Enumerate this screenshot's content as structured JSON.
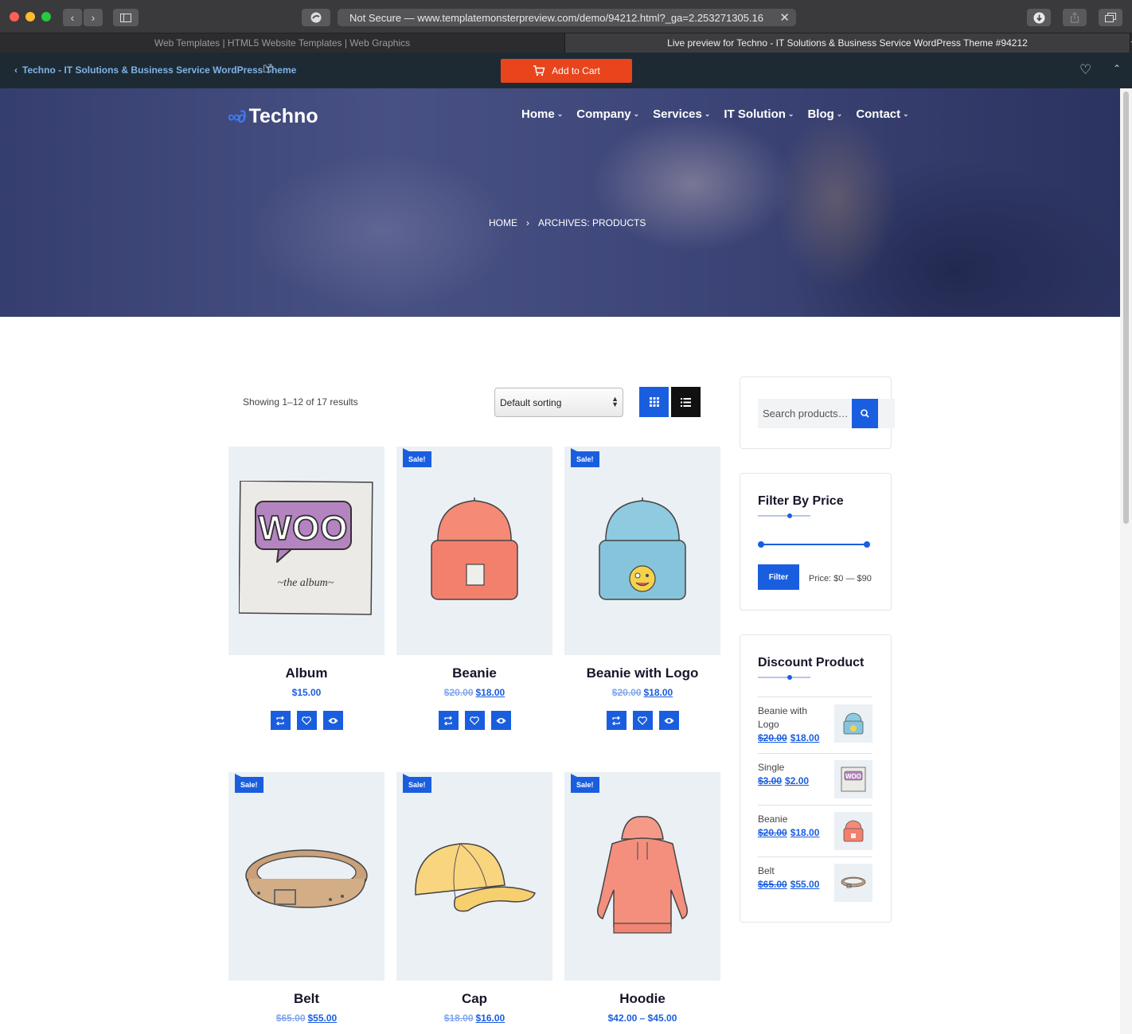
{
  "browser": {
    "url_text": "Not Secure — www.templatemonsterpreview.com/demo/94212.html?_ga=2.253271305.16",
    "tabs": [
      {
        "label": "Web Templates | HTML5 Website Templates | Web Graphics",
        "active": false
      },
      {
        "label": "Live preview for Techno - IT Solutions & Business Service WordPress Theme #94212",
        "active": true
      }
    ]
  },
  "preview_bar": {
    "back_label": "Techno - IT Solutions & Business Service WordPress Theme",
    "add_to_cart_label": "Add to Cart",
    "accent_color": "#e8451d"
  },
  "site": {
    "logo_text": "Techno",
    "menu": [
      "Home",
      "Company",
      "Services",
      "IT Solution",
      "Blog",
      "Contact"
    ],
    "breadcrumb": {
      "home": "HOME",
      "current": "ARCHIVES: PRODUCTS"
    },
    "brand_color": "#1a5ee0"
  },
  "shop": {
    "results_text": "Showing 1–12 of 17 results",
    "sort_selected": "Default sorting",
    "sale_badge": "Sale!",
    "products": [
      {
        "name": "Album",
        "price": "$15.00",
        "old_price": "",
        "sale": false,
        "image": "album-image"
      },
      {
        "name": "Beanie",
        "price": "$18.00",
        "old_price": "$20.00",
        "sale": true,
        "image": "beanie-image"
      },
      {
        "name": "Beanie with Logo",
        "price": "$18.00",
        "old_price": "$20.00",
        "sale": true,
        "image": "beanie-logo-image"
      },
      {
        "name": "Belt",
        "price": "$55.00",
        "old_price": "$65.00",
        "sale": true,
        "image": "belt-image"
      },
      {
        "name": "Cap",
        "price": "$16.00",
        "old_price": "$18.00",
        "sale": true,
        "image": "cap-image"
      },
      {
        "name": "Hoodie",
        "price": "$42.00 – $45.00",
        "old_price": "",
        "sale": true,
        "image": "hoodie-image"
      }
    ]
  },
  "sidebar": {
    "search_placeholder": "Search products…",
    "filter": {
      "title": "Filter By Price",
      "button": "Filter",
      "range_text": "Price: $0 — $90"
    },
    "discount": {
      "title": "Discount Product",
      "items": [
        {
          "name": "Beanie with Logo",
          "old_price": "$20.00",
          "price": "$18.00",
          "image": "beanie-logo-image"
        },
        {
          "name": "Single",
          "old_price": "$3.00",
          "price": "$2.00",
          "image": "album-image"
        },
        {
          "name": "Beanie",
          "old_price": "$20.00",
          "price": "$18.00",
          "image": "beanie-image"
        },
        {
          "name": "Belt",
          "old_price": "$65.00",
          "price": "$55.00",
          "image": "belt-image"
        }
      ]
    }
  }
}
